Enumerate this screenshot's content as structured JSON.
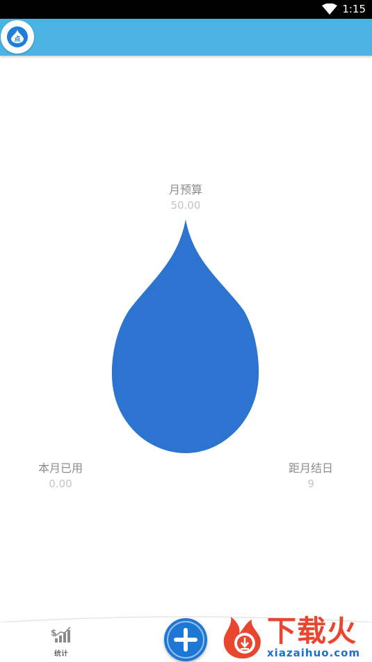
{
  "status_bar": {
    "time": "1:15"
  },
  "app_logo": {
    "char": "点"
  },
  "budget": {
    "label": "月预算",
    "value": "50.00"
  },
  "used": {
    "label": "本月已用",
    "value": "0.00"
  },
  "days_left": {
    "label": "距月结日",
    "value": "9"
  },
  "bottom_nav": {
    "stats_label": "统计"
  },
  "watermark": {
    "title": "下载火",
    "subtitle": "xiazaihuo.com"
  },
  "colors": {
    "app_bar": "#4ab3e4",
    "drop": "#2c74cf",
    "add_button": "#1f77d4",
    "watermark_red": "#e8462e",
    "watermark_blue": "#1f6fc8"
  }
}
